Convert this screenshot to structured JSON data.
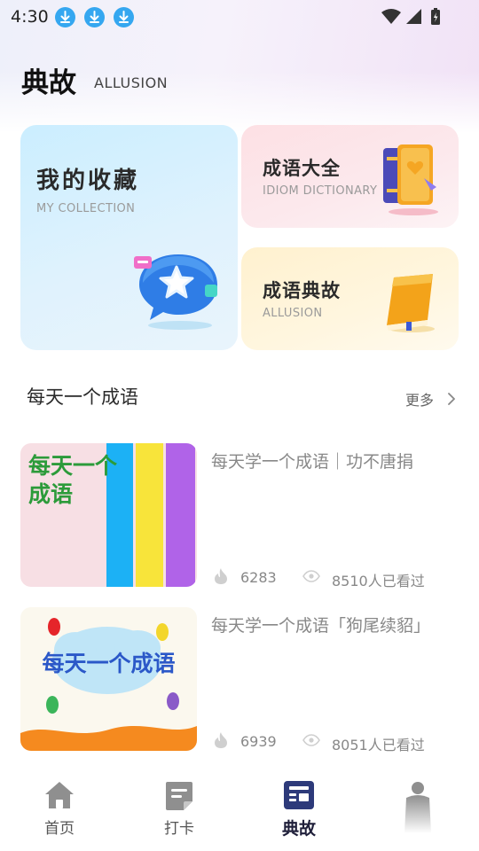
{
  "status_bar": {
    "time": "4:30",
    "download_icons": [
      "download-icon",
      "download-icon",
      "download-icon"
    ],
    "system_icons": [
      "wifi-icon",
      "signal-icon",
      "battery-icon"
    ]
  },
  "header": {
    "title": "典故",
    "subtitle": "ALLUSION"
  },
  "cards": {
    "collection": {
      "title": "我的收藏",
      "subtitle": "MY COLLECTION"
    },
    "dictionary": {
      "title": "成语大全",
      "subtitle": "IDIOM DICTIONARY"
    },
    "allusion": {
      "title": "成语典故",
      "subtitle": "ALLUSION"
    }
  },
  "section": {
    "title": "每天一个成语",
    "more_label": "更多"
  },
  "items": [
    {
      "title": "每天学一个成语｜功不唐捐",
      "likes": "6283",
      "views": "8510人已看过",
      "thumb_text_line1": "每天一个",
      "thumb_text_line2": "成语"
    },
    {
      "title": "每天学一个成语「狗尾续貂」",
      "likes": "6939",
      "views": "8051人已看过",
      "thumb_text": "每天一个成语"
    }
  ],
  "nav": [
    {
      "label": "首页",
      "icon": "home-icon",
      "active": false
    },
    {
      "label": "打卡",
      "icon": "checkin-icon",
      "active": false
    },
    {
      "label": "典故",
      "icon": "allusion-icon",
      "active": true
    },
    {
      "label": "",
      "icon": "profile-icon",
      "active": false
    }
  ],
  "colors": {
    "accent": "#2d3a7a",
    "download_blue": "#35a7f0",
    "collection_card": "#cbeeff",
    "dictionary_card": "#fde0e4",
    "allusion_card": "#fff1cf"
  }
}
